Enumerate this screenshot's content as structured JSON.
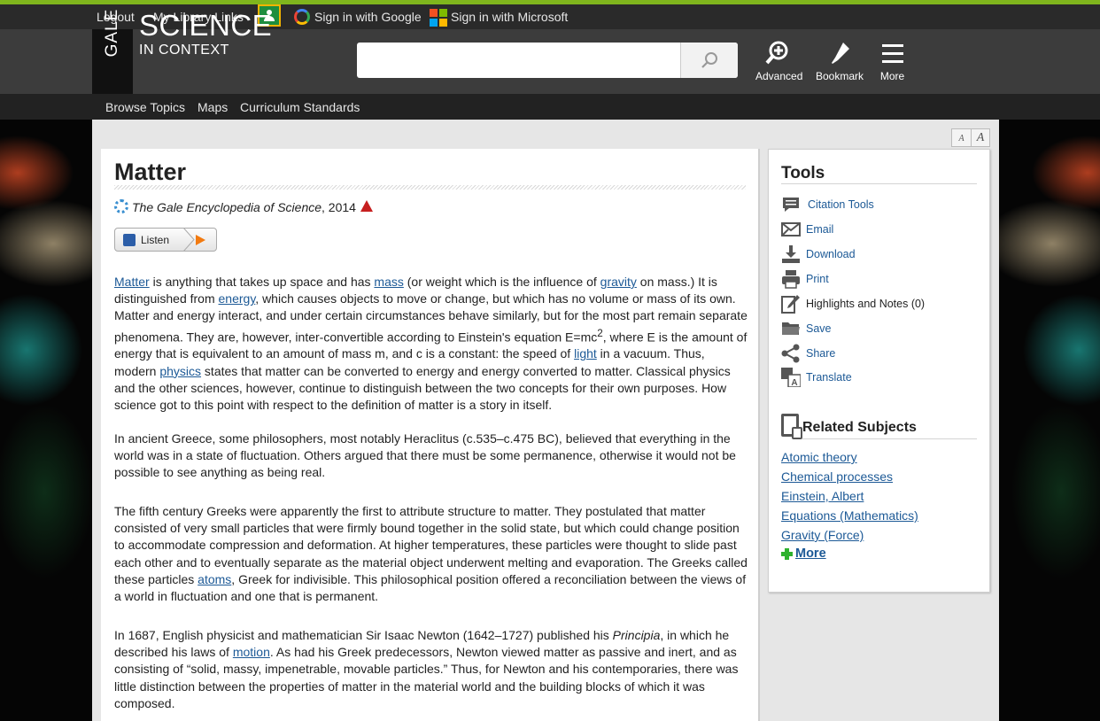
{
  "util_bar": {
    "logout": "Logout",
    "library_links": "My Library Links",
    "google_signin": "Sign in with Google",
    "microsoft_signin": "Sign in with Microsoft"
  },
  "brand": {
    "gale": "GALE",
    "science": "SCIENCE",
    "in_context": "IN CONTEXT"
  },
  "search": {
    "value": "",
    "placeholder": ""
  },
  "header_buttons": {
    "advanced": "Advanced",
    "bookmark": "Bookmark",
    "more": "More"
  },
  "nav": {
    "items": [
      "Browse Topics",
      "Maps",
      "Curriculum Standards"
    ]
  },
  "font_size": {
    "small": "A",
    "large": "A"
  },
  "article": {
    "title": "Matter",
    "source_title": "The Gale Encyclopedia of Science",
    "source_year": ", 2014",
    "listen_label": "Listen",
    "p1": [
      {
        "link": "Matter"
      },
      {
        "text": " is anything that takes up space and has "
      },
      {
        "link": "mass"
      },
      {
        "text": " (or weight which is the influence of "
      },
      {
        "link": "gravity"
      },
      {
        "text": " on mass.) It is distinguished from "
      },
      {
        "link": "energy"
      },
      {
        "text": ", which causes objects to move or change, but which has no volume or mass of its own. Matter and energy interact, and under certain circumstances behave similarly, but for the most part remain separate phenomena. They are, however, inter-convertible according to Einstein's equation E=mc"
      },
      {
        "sup": "2"
      },
      {
        "text": ", where E is the amount of energy that is equivalent to an amount of mass m, and c is a constant: the speed of "
      },
      {
        "link": "light"
      },
      {
        "text": " in a vacuum. Thus, modern "
      },
      {
        "link": "physics"
      },
      {
        "text": " states that matter can be converted to energy and energy converted to matter. Classical physics and the other sciences, however, continue to distinguish between the two concepts for their own purposes. How science got to this point with respect to the definition of matter is a story in itself."
      }
    ],
    "p2": [
      {
        "text": "In ancient Greece, some philosophers, most notably Heraclitus (c.535–c.475 BC), believed that everything in the world was in a state of fluctuation. Others argued that there must be some permanence, otherwise it would not be possible to see anything as being real."
      }
    ],
    "p3": [
      {
        "text": "The fifth century Greeks were apparently the first to attribute structure to matter. They postulated that matter consisted of very small particles that were firmly bound together in the solid state, but which could change position to accommodate compression and deformation. At higher temperatures, these particles were thought to slide past each other and to eventually separate as the material object underwent melting and evaporation. The Greeks called these particles "
      },
      {
        "link": "atoms"
      },
      {
        "text": ", Greek for indivisible. This philosophical position offered a reconciliation between the views of a world in fluctuation and one that is permanent."
      }
    ],
    "p4": [
      {
        "text": "In 1687, English physicist and mathematician Sir Isaac Newton (1642–1727) published his "
      },
      {
        "em": "Principia"
      },
      {
        "text": ", in which he described his laws of "
      },
      {
        "link": "motion"
      },
      {
        "text": ". As had his Greek predecessors, Newton viewed matter as passive and inert, and as consisting of “solid, massy, impenetrable, movable particles.” Thus, for Newton and his contemporaries, there was little distinction between the properties of matter in the material world and the building blocks of which it was composed."
      }
    ]
  },
  "tools": {
    "heading": "Tools",
    "items": [
      {
        "label": "Citation Tools",
        "icon": "citation-icon"
      },
      {
        "label": "Email",
        "icon": "email-icon"
      },
      {
        "label": "Download",
        "icon": "download-icon"
      },
      {
        "label": "Print",
        "icon": "print-icon"
      },
      {
        "label": "Highlights and Notes (0)",
        "icon": "highlight-icon"
      },
      {
        "label": "Save",
        "icon": "folder-icon"
      },
      {
        "label": "Share",
        "icon": "share-icon"
      },
      {
        "label": "Translate",
        "icon": "translate-icon"
      }
    ]
  },
  "related": {
    "heading": "Related Subjects",
    "items": [
      "Atomic theory",
      "Chemical processes",
      "Einstein, Albert",
      "Equations (Mathematics)",
      "Gravity (Force)"
    ],
    "more": "More"
  },
  "colors": {
    "accent_green": "#7fb51d",
    "link": "#1c5996",
    "header_bg": "#3c3c3c",
    "topbar_bg": "#2a2a2a"
  }
}
